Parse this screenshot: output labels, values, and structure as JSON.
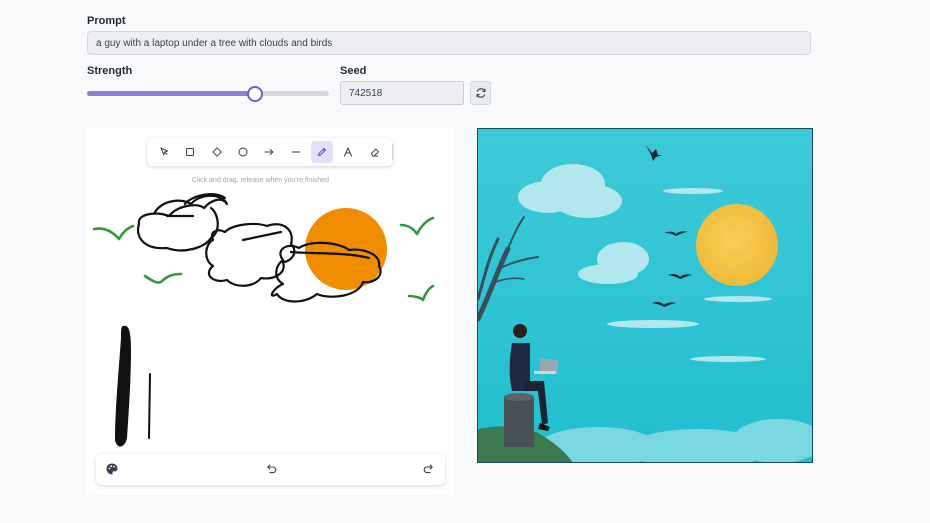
{
  "prompt": {
    "label": "Prompt",
    "value": "a guy with a laptop under a tree with clouds and birds"
  },
  "strength": {
    "label": "Strength",
    "value_fraction": 0.69
  },
  "seed": {
    "label": "Seed",
    "value": "742518",
    "regenerate_icon": "refresh-icon"
  },
  "sketch": {
    "toolbar": {
      "tools": [
        {
          "name": "selection",
          "icon": "cursor-icon",
          "active": false
        },
        {
          "name": "rectangle",
          "icon": "square-icon",
          "active": false
        },
        {
          "name": "diamond",
          "icon": "diamond-icon",
          "active": false
        },
        {
          "name": "ellipse",
          "icon": "circle-icon",
          "active": false
        },
        {
          "name": "arrow",
          "icon": "arrow-right-icon",
          "active": false
        },
        {
          "name": "line",
          "icon": "line-icon",
          "active": false
        },
        {
          "name": "draw",
          "icon": "pencil-icon",
          "active": true
        },
        {
          "name": "text",
          "icon": "text-icon",
          "active": false
        },
        {
          "name": "eraser",
          "icon": "eraser-icon",
          "active": false
        }
      ]
    },
    "hint": "Click and drag, release when you're finished",
    "bottom_bar": {
      "palette_icon": "palette-icon",
      "undo_icon": "undo-icon",
      "redo_icon": "redo-icon"
    }
  },
  "colors": {
    "accent": "#6d5fc4",
    "sun": "#ef8c00",
    "birds": "#2e9a3e",
    "sky": "#2cc3d4"
  }
}
